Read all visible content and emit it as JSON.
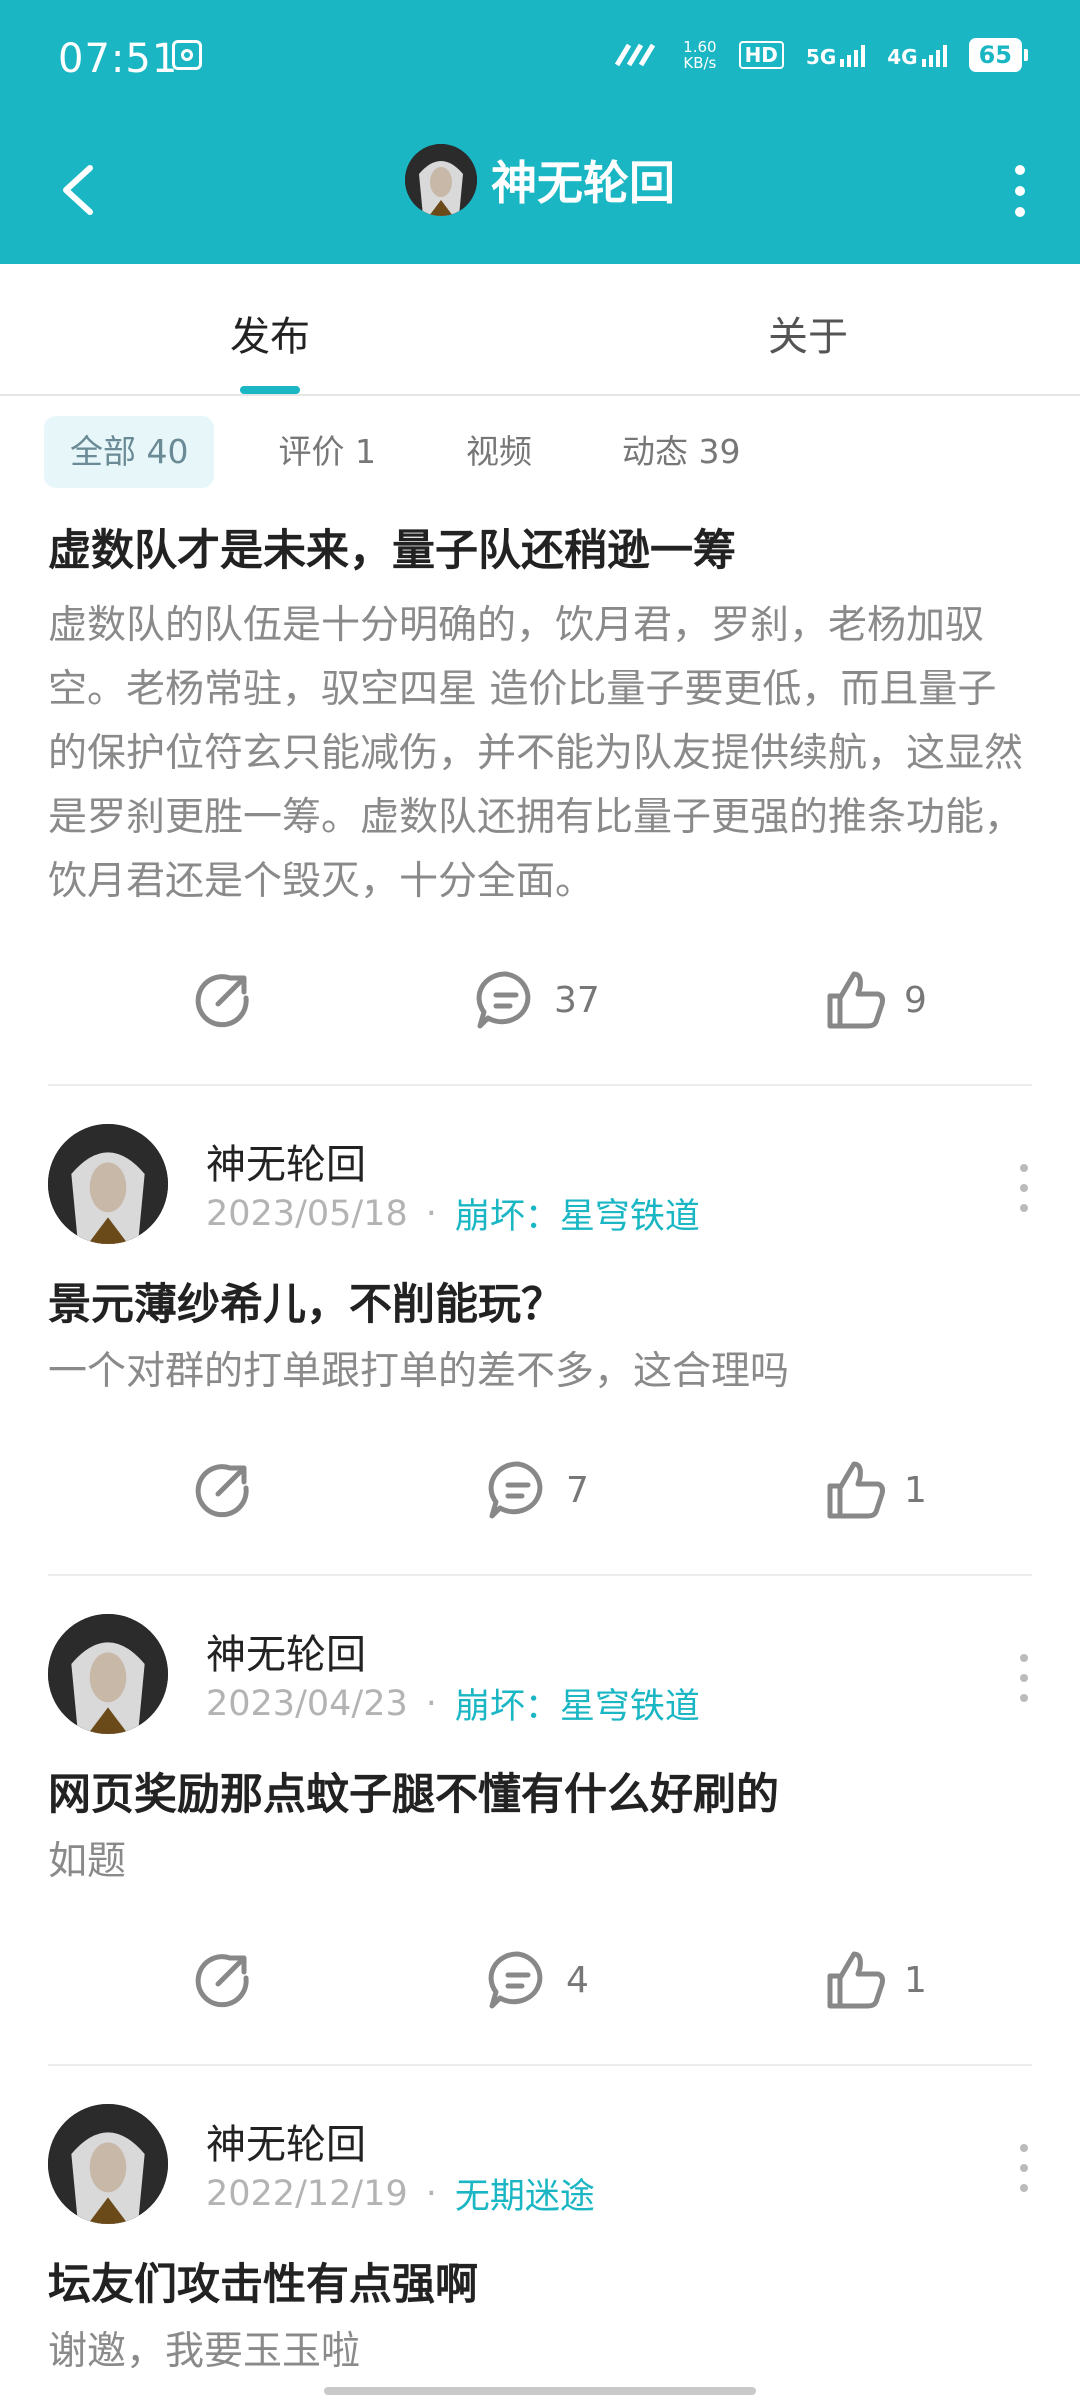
{
  "status_bar": {
    "time": "07:51",
    "speed_value": "1.60",
    "speed_unit": "KB/s",
    "hd": "HD",
    "sim1": "5G",
    "sim2": "4G",
    "battery": "65"
  },
  "header": {
    "title": "神无轮回"
  },
  "tabs": {
    "active": "发布",
    "other": "关于"
  },
  "filters": [
    {
      "label": "全部 40",
      "selected": true
    },
    {
      "label": "评价 1"
    },
    {
      "label": "视频"
    },
    {
      "label": "动态 39"
    }
  ],
  "posts": [
    {
      "title": "虚数队才是未来，量子队还稍逊一筹",
      "body": "虚数队的队伍是十分明确的，饮月君，罗刹，老杨加驭空。老杨常驻，驭空四星 造价比量子要更低，而且量子的保护位符玄只能减伤，并不能为队友提供续航，这显然是罗刹更胜一筹。虚数队还拥有比量子更强的推条功能，饮月君还是个毁灭，十分全面。",
      "comments": "37",
      "likes": "9"
    },
    {
      "author": "神无轮回",
      "date": "2023/05/18",
      "game": "崩坏：星穹铁道",
      "title": "景元薄纱希儿，不削能玩？",
      "body": "一个对群的打单跟打单的差不多，这合理吗",
      "comments": "7",
      "likes": "1"
    },
    {
      "author": "神无轮回",
      "date": "2023/04/23",
      "game": "崩坏：星穹铁道",
      "title": "网页奖励那点蚊子腿不懂有什么好刷的",
      "body": "如题",
      "comments": "4",
      "likes": "1"
    },
    {
      "author": "神无轮回",
      "date": "2022/12/19",
      "game": "无期迷途",
      "title": "坛友们攻击性有点强啊",
      "body": "谢邀，我要玉玉啦"
    }
  ],
  "colors": {
    "accent": "#1ab6c4",
    "muted_text": "#8a8a8a"
  },
  "icons": [
    "back-arrow-icon",
    "more-vertical-icon",
    "share-icon",
    "comment-icon",
    "like-icon"
  ]
}
